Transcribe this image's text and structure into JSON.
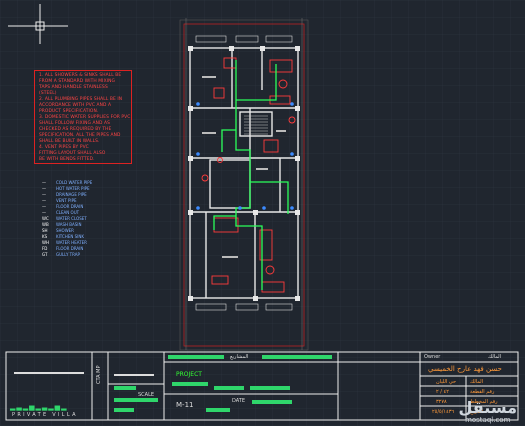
{
  "notes": {
    "lines": [
      "1.  ALL SHOWERS & SINKS SHALL BE",
      "FROM A STANDARD WITH MIXING",
      "TAPS AND HANDLE STAINLESS",
      "(STEEL)",
      "2.  ALL PLUMBING PIPES SHALL BE IN",
      "ACCORDANCE WITH PVC  AND A",
      "PRODUCT SPECIFICATION.",
      "3.  DOMESTIC WATER SUPPLIES FOR PVC",
      "SHALL FOLLOW FIXING AND AS",
      "CHECKED AS REQUIRED BY THE",
      "SPECIFICATION. ALL THE PIPES AND",
      "SHALL BE BUILT IN  WALLS.",
      "4.  VENT PIPES BY PVC",
      "FITTING LAYOUT SHALL ALSO",
      "BE WITH BENDS FITTED."
    ]
  },
  "legend": {
    "rows": [
      {
        "key": "—",
        "label": "COLD WATER PIPE"
      },
      {
        "key": "—",
        "label": "HOT WATER PIPE"
      },
      {
        "key": "—",
        "label": "DRAINAGE PIPE"
      },
      {
        "key": "—",
        "label": "VENT PIPE"
      },
      {
        "key": "—",
        "label": "FLOOR DRAIN"
      },
      {
        "key": "—",
        "label": "CLEAN OUT"
      },
      {
        "key": "WC",
        "label": "WATER CLOSET"
      },
      {
        "key": "WB",
        "label": "WASH BASIN"
      },
      {
        "key": "SH",
        "label": "SHOWER"
      },
      {
        "key": "KS",
        "label": "KITCHEN SINK"
      },
      {
        "key": "WH",
        "label": "WATER HEATER"
      },
      {
        "key": "FD",
        "label": "FLOOR DRAIN"
      },
      {
        "key": "GT",
        "label": "GULLY TRAP"
      }
    ]
  },
  "titleblock": {
    "company": "PRIVATE VILLA",
    "owner_label": "Owner",
    "owner_label_ar": "المالك",
    "owner_name": "حسن فهد عارح الخميسي",
    "project_ar": "فيلا سكنية",
    "location_ar": "حي الليان",
    "drawing_no": "M-11",
    "plot_label": "PROJECT",
    "scale_label": "SCALE",
    "date_label": "DATE",
    "rows_ar": [
      "المالك",
      "رقم القطعة",
      "رقم المخطط",
      "رقم الصك",
      "التاريخ"
    ],
    "values": [
      "٤٢ / ٢",
      "٣٢٧٨",
      "٢٥/٥/١٤٣٦",
      "٢٠١٣/٠٣"
    ],
    "page_section_ar": "المشاريع",
    "vertical_text": "CTA MP"
  },
  "watermark": {
    "arabic": "مستقل",
    "latin": "mostaql.com"
  }
}
